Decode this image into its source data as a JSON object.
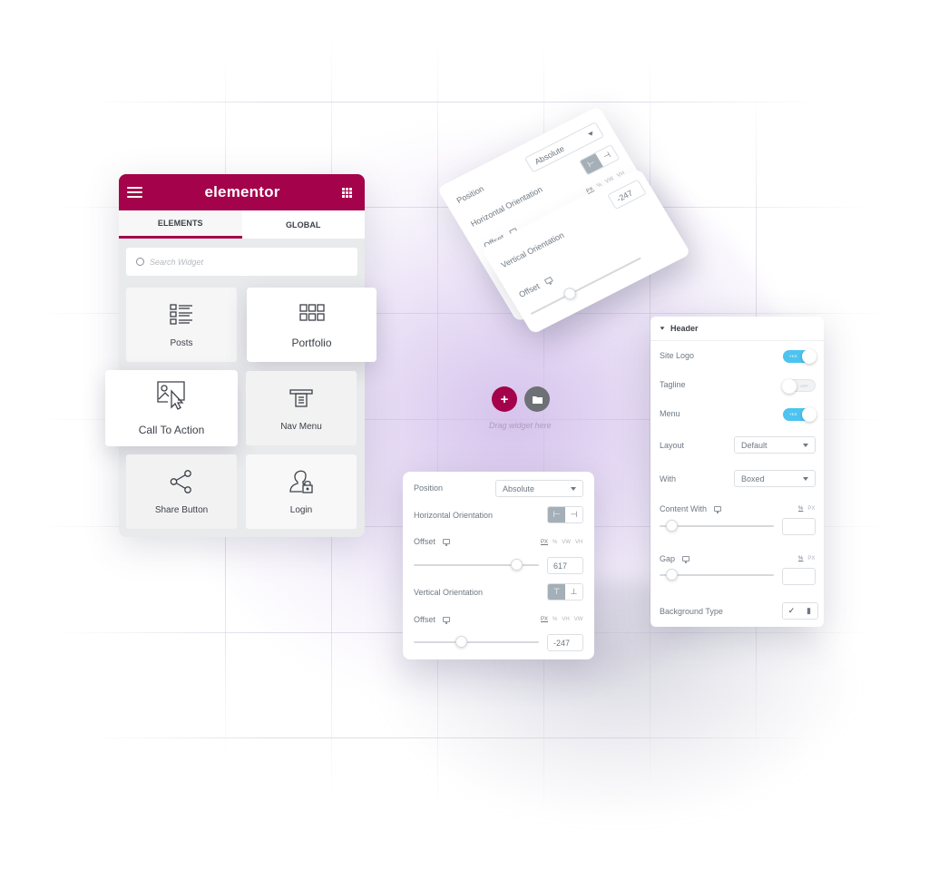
{
  "colors": {
    "brand": "#a4024a",
    "toggle_on": "#4dc3f0",
    "active_button": "#a4afb7",
    "folder_button": "#6d7175"
  },
  "elementor_panel": {
    "logo": "elementor",
    "menu_icon": "hamburger-icon",
    "apps_icon": "grid-icon",
    "tabs": [
      {
        "label": "ELEMENTS",
        "active": true
      },
      {
        "label": "GLOBAL",
        "active": false
      }
    ],
    "search": {
      "placeholder": "Search Widget",
      "value": ""
    },
    "widgets": [
      {
        "label": "Posts",
        "icon": "posts-list-icon"
      },
      {
        "label": "Portfolio",
        "icon": "portfolio-grid-icon"
      },
      {
        "label": "Call To Action",
        "icon": "call-to-action-icon"
      },
      {
        "label": "Nav Menu",
        "icon": "nav-menu-icon"
      },
      {
        "label": "Share Button",
        "icon": "share-icon"
      },
      {
        "label": "Login",
        "icon": "login-user-lock-icon"
      }
    ]
  },
  "canvas": {
    "add_icon": "plus-icon",
    "folder_icon": "folder-icon",
    "drag_hint": "Drag widget here"
  },
  "position_panel": {
    "position_label": "Position",
    "position_value": "Absolute",
    "horizontal_label": "Horizontal Orientation",
    "horizontal_options": [
      "left-align-icon",
      "right-align-icon"
    ],
    "horizontal_active": 0,
    "offset_label": "Offset",
    "h_units": [
      "PX",
      "%",
      "VW",
      "VH"
    ],
    "h_unit_active": "PX",
    "h_offset_value": "617",
    "h_slider_fraction": 0.82,
    "vertical_label": "Vertical Orientation",
    "vertical_options": [
      "top-align-icon",
      "bottom-align-icon"
    ],
    "vertical_active": 0,
    "v_units": [
      "PX",
      "%",
      "VH",
      "VW"
    ],
    "v_unit_active": "PX",
    "v_offset_value": "-247",
    "v_slider_fraction": 0.38
  },
  "header_panel": {
    "section_title": "Header",
    "rows": {
      "site_logo": {
        "label": "Site Logo",
        "toggle": true,
        "toggle_text": "YES"
      },
      "tagline": {
        "label": "Tagline",
        "toggle": false,
        "toggle_text": "OFF"
      },
      "menu": {
        "label": "Menu",
        "toggle": true,
        "toggle_text": "YES"
      },
      "layout": {
        "label": "Layout",
        "value": "Default"
      },
      "width": {
        "label": "With",
        "value": "Boxed"
      },
      "content_width": {
        "label": "Content With",
        "units": [
          "%",
          "PX"
        ],
        "unit_active": "%",
        "value": "",
        "slider_fraction": 0.05
      },
      "gap": {
        "label": "Gap",
        "units": [
          "%",
          "PX"
        ],
        "unit_active": "%",
        "value": "",
        "slider_fraction": 0.05
      },
      "background_type": {
        "label": "Background Type",
        "options": [
          "brush-icon",
          "gradient-icon"
        ]
      }
    }
  }
}
